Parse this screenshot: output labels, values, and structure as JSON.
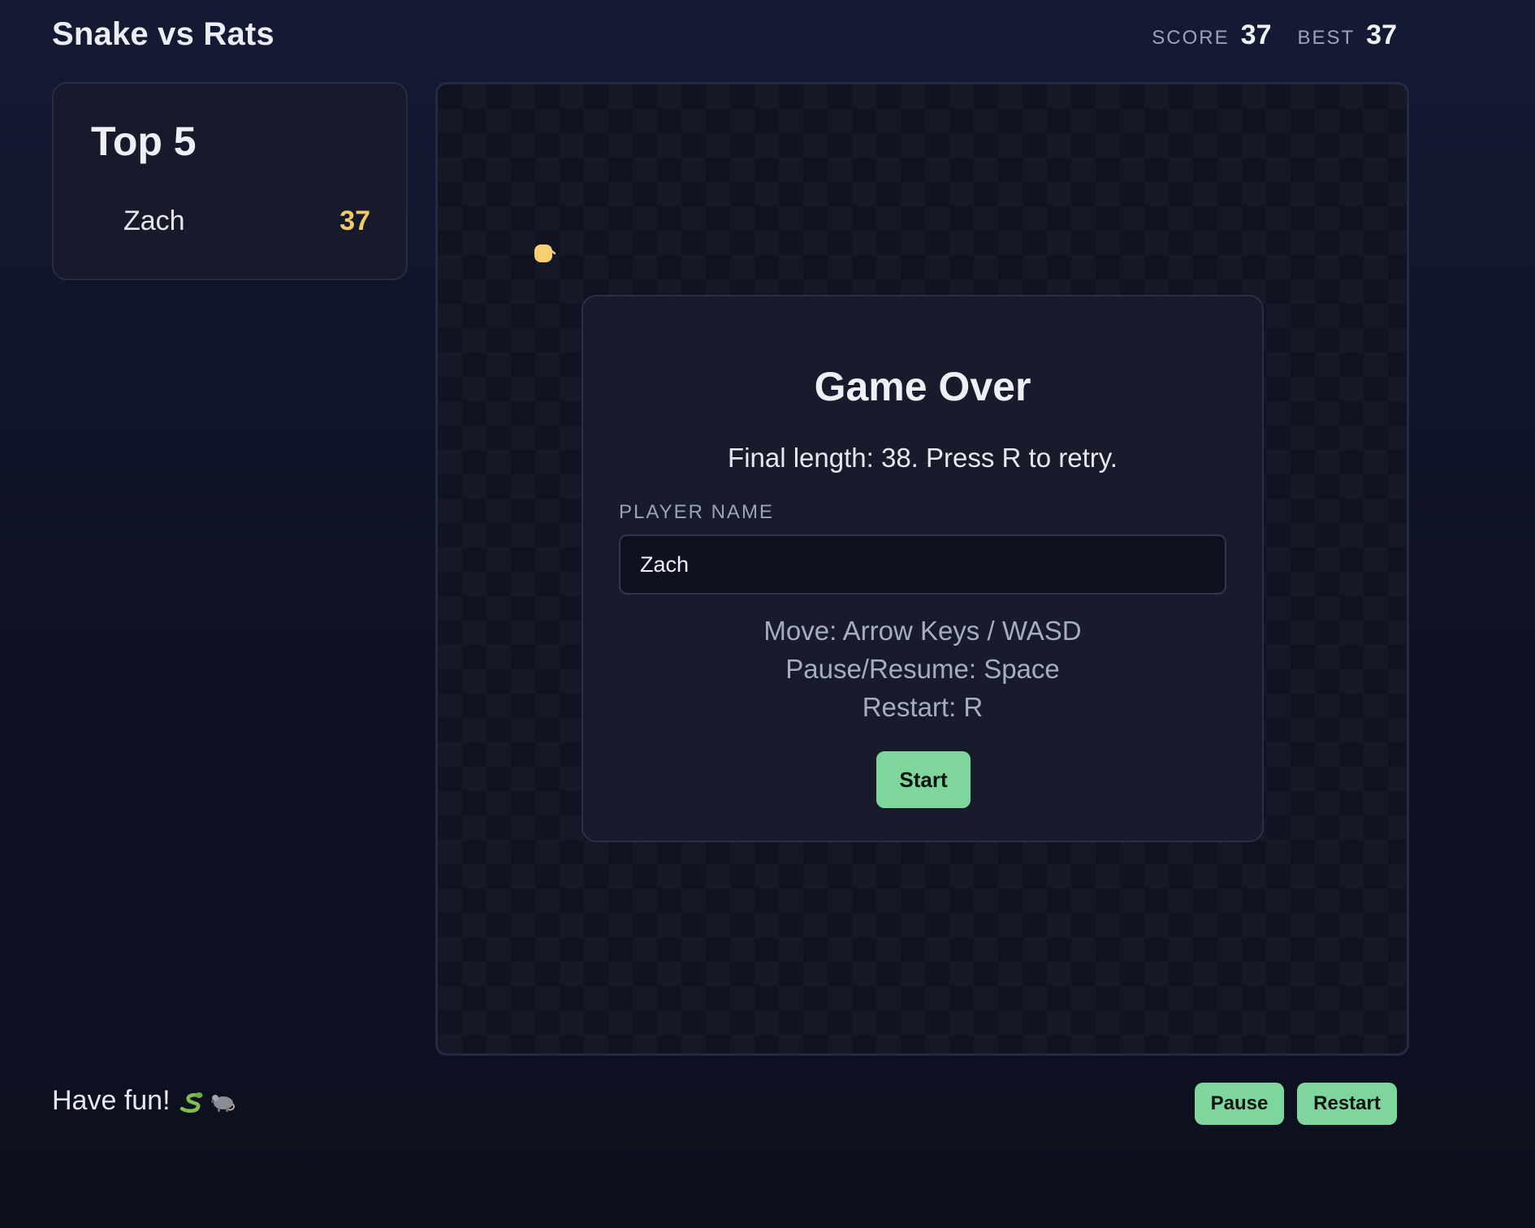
{
  "header": {
    "title": "Snake vs Rats",
    "score_label": "SCORE",
    "score_value": "37",
    "best_label": "BEST",
    "best_value": "37"
  },
  "leaderboard": {
    "title": "Top 5",
    "entries": [
      {
        "name": "Zach",
        "score": "37"
      }
    ]
  },
  "board": {
    "rat_color": "#f6cf6e",
    "checker_colors": [
      "#0f1322",
      "#13182a"
    ]
  },
  "overlay": {
    "title": "Game Over",
    "subtitle": "Final length: 38. Press R to retry.",
    "name_label": "PLAYER NAME",
    "name_value": "Zach",
    "help": [
      "Move: Arrow Keys / WASD",
      "Pause/Resume: Space",
      "Restart: R"
    ],
    "start_label": "Start"
  },
  "footer": {
    "message": "Have fun!",
    "icons": [
      "snake-icon",
      "rat-icon"
    ],
    "pause_label": "Pause",
    "restart_label": "Restart"
  },
  "colors": {
    "accent": "#7fd69c",
    "gold": "#f4c96a",
    "panel": "#161a2b"
  }
}
